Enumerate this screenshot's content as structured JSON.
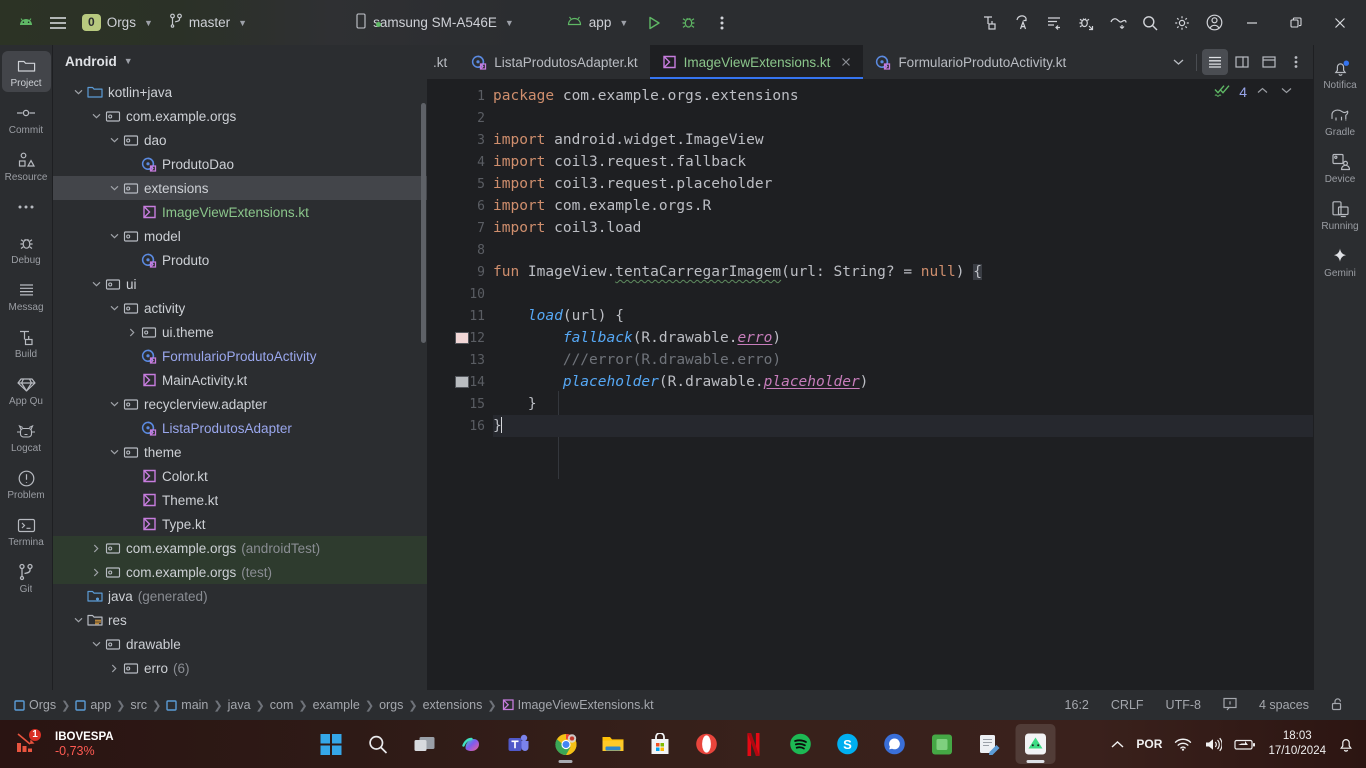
{
  "toolbar": {
    "project_badge": "0",
    "project_name": "Orgs",
    "branch": "master",
    "device": "samsung SM-A546E",
    "run_config": "app",
    "icons": {
      "menu": "hamburger-menu-icon",
      "android": "android-logo-icon",
      "branch": "git-branch-icon",
      "device": "phone-icon",
      "run": "run-play-icon",
      "debug": "debug-bug-icon",
      "more": "more-vertical-icon",
      "build": "build-hammer-icon",
      "translate": "code-with-me-icon",
      "lint": "inspections-icon",
      "attach_debug": "attach-debugger-icon",
      "profiler": "profiler-icon",
      "search": "search-icon",
      "settings": "gear-icon",
      "account": "account-icon",
      "minimize": "minimize-icon",
      "maximize": "restore-icon",
      "close": "close-icon"
    }
  },
  "left_rail": [
    {
      "label": "Project",
      "icon": "folder-icon",
      "active": true
    },
    {
      "label": "Commit",
      "icon": "commit-icon",
      "active": false
    },
    {
      "label": "Resource",
      "icon": "resource-manager-icon",
      "active": false
    },
    {
      "label": "",
      "icon": "more-horizontal-icon",
      "active": false
    },
    {
      "label": "Debug",
      "icon": "debug-bug-icon",
      "active": false
    },
    {
      "label": "Messag",
      "icon": "messages-icon",
      "active": false
    },
    {
      "label": "Build",
      "icon": "build-hammer-icon",
      "active": false
    },
    {
      "label": "App Qu",
      "icon": "app-quality-icon",
      "active": false
    },
    {
      "label": "Logcat",
      "icon": "logcat-cat-icon",
      "active": false
    },
    {
      "label": "Problem",
      "icon": "problems-icon",
      "active": false
    },
    {
      "label": "Termina",
      "icon": "terminal-icon",
      "active": false
    },
    {
      "label": "Git",
      "icon": "git-branch-icon",
      "active": false
    }
  ],
  "right_rail": [
    {
      "label": "Notifica",
      "icon": "notifications-bell-icon",
      "dot": true
    },
    {
      "label": "Gradle",
      "icon": "gradle-elephant-icon",
      "dot": false
    },
    {
      "label": "Device ",
      "icon": "device-manager-icon",
      "dot": false
    },
    {
      "label": "Running",
      "icon": "running-devices-icon",
      "dot": false
    },
    {
      "label": "Gemini",
      "icon": "gemini-sparkle-icon",
      "dot": false
    }
  ],
  "project_panel": {
    "title": "Android",
    "tree": [
      {
        "depth": 1,
        "arrow": "down",
        "icon": "folder-blue",
        "label": "kotlin+java",
        "color": ""
      },
      {
        "depth": 2,
        "arrow": "down",
        "icon": "package",
        "label": "com.example.orgs",
        "color": ""
      },
      {
        "depth": 3,
        "arrow": "down",
        "icon": "package",
        "label": "dao",
        "color": ""
      },
      {
        "depth": 4,
        "arrow": "none",
        "icon": "kt-class",
        "label": "ProdutoDao",
        "color": ""
      },
      {
        "depth": 3,
        "arrow": "down",
        "icon": "package",
        "label": "extensions",
        "color": "",
        "selected": true
      },
      {
        "depth": 4,
        "arrow": "none",
        "icon": "kt-file",
        "label": "ImageViewExtensions.kt",
        "color": "green"
      },
      {
        "depth": 3,
        "arrow": "down",
        "icon": "package",
        "label": "model",
        "color": ""
      },
      {
        "depth": 4,
        "arrow": "none",
        "icon": "kt-class",
        "label": "Produto",
        "color": ""
      },
      {
        "depth": 2,
        "arrow": "down",
        "icon": "package",
        "label": "ui",
        "color": ""
      },
      {
        "depth": 3,
        "arrow": "down",
        "icon": "package",
        "label": "activity",
        "color": ""
      },
      {
        "depth": 4,
        "arrow": "right",
        "icon": "package",
        "label": "ui.theme",
        "color": ""
      },
      {
        "depth": 4,
        "arrow": "none",
        "icon": "kt-class",
        "label": "FormularioProdutoActivity",
        "color": "blue"
      },
      {
        "depth": 4,
        "arrow": "none",
        "icon": "kt-file",
        "label": "MainActivity.kt",
        "color": ""
      },
      {
        "depth": 3,
        "arrow": "down",
        "icon": "package",
        "label": "recyclerview.adapter",
        "color": ""
      },
      {
        "depth": 4,
        "arrow": "none",
        "icon": "kt-class",
        "label": "ListaProdutosAdapter",
        "color": "blue"
      },
      {
        "depth": 3,
        "arrow": "down",
        "icon": "package",
        "label": "theme",
        "color": ""
      },
      {
        "depth": 4,
        "arrow": "none",
        "icon": "kt-file",
        "label": "Color.kt",
        "color": ""
      },
      {
        "depth": 4,
        "arrow": "none",
        "icon": "kt-file",
        "label": "Theme.kt",
        "color": ""
      },
      {
        "depth": 4,
        "arrow": "none",
        "icon": "kt-file",
        "label": "Type.kt",
        "color": ""
      },
      {
        "depth": 2,
        "arrow": "right",
        "icon": "package",
        "label": "com.example.orgs",
        "muted": "(androidTest)",
        "testsrc": true
      },
      {
        "depth": 2,
        "arrow": "right",
        "icon": "package",
        "label": "com.example.orgs",
        "muted": "(test)",
        "testsrc": true
      },
      {
        "depth": 1,
        "arrow": "none",
        "icon": "folder-gen",
        "label": "java",
        "muted": "(generated)"
      },
      {
        "depth": 1,
        "arrow": "down",
        "icon": "folder-res",
        "label": "res"
      },
      {
        "depth": 2,
        "arrow": "down",
        "icon": "package",
        "label": "drawable"
      },
      {
        "depth": 3,
        "arrow": "right",
        "icon": "package",
        "label": "erro",
        "muted": "(6)"
      }
    ]
  },
  "editor": {
    "tabs": [
      {
        "label": ".kt",
        "icon": "",
        "active": false,
        "partial": true
      },
      {
        "label": "ListaProdutosAdapter.kt",
        "icon": "kt-class",
        "active": false
      },
      {
        "label": "ImageViewExtensions.kt",
        "icon": "kt-file",
        "active": true,
        "closable": true
      },
      {
        "label": "FormularioProdutoActivity.kt",
        "icon": "kt-class",
        "active": false
      }
    ],
    "tab_actions": {
      "chevron": "chevron-down-icon",
      "list": "file-structure-icon",
      "split": "split-editor-icon",
      "preview": "preview-icon",
      "more": "more-vertical-icon"
    },
    "inspection": {
      "status_icon": "inspections-ok-icon",
      "count": "4",
      "up": "▲",
      "down": "▼"
    },
    "lines": [
      {
        "n": "1",
        "segments": [
          {
            "t": "package ",
            "c": "k"
          },
          {
            "t": "com.example.orgs.extensions",
            "c": ""
          }
        ]
      },
      {
        "n": "2",
        "segments": []
      },
      {
        "n": "3",
        "segments": [
          {
            "t": "import ",
            "c": "k"
          },
          {
            "t": "android.widget.ImageView",
            "c": ""
          }
        ]
      },
      {
        "n": "4",
        "segments": [
          {
            "t": "import ",
            "c": "k"
          },
          {
            "t": "coil3.request.fallback",
            "c": ""
          }
        ]
      },
      {
        "n": "5",
        "segments": [
          {
            "t": "import ",
            "c": "k"
          },
          {
            "t": "coil3.request.placeholder",
            "c": ""
          }
        ]
      },
      {
        "n": "6",
        "segments": [
          {
            "t": "import ",
            "c": "k"
          },
          {
            "t": "com.example.orgs.R",
            "c": ""
          }
        ]
      },
      {
        "n": "7",
        "segments": [
          {
            "t": "import ",
            "c": "k"
          },
          {
            "t": "coil3.load",
            "c": ""
          }
        ]
      },
      {
        "n": "8",
        "segments": []
      },
      {
        "n": "9",
        "segments": [
          {
            "t": "fun ",
            "c": "k"
          },
          {
            "t": "ImageView.",
            "c": ""
          },
          {
            "t": "tentaCarregarImagem",
            "c": "squig"
          },
          {
            "t": "(url: String? = ",
            "c": ""
          },
          {
            "t": "null",
            "c": "k"
          },
          {
            "t": ") ",
            "c": ""
          },
          {
            "t": "{",
            "c": "brace"
          }
        ]
      },
      {
        "n": "10",
        "segments": []
      },
      {
        "n": "11",
        "segments": [
          {
            "t": "    ",
            "c": ""
          },
          {
            "t": "load",
            "c": "it"
          },
          {
            "t": "(url) {",
            "c": ""
          }
        ]
      },
      {
        "n": "12",
        "swatch": "#f2d7d7",
        "segments": [
          {
            "t": "        ",
            "c": ""
          },
          {
            "t": "fallback",
            "c": "it"
          },
          {
            "t": "(R.drawable.",
            "c": ""
          },
          {
            "t": "erro",
            "c": "res"
          },
          {
            "t": ")",
            "c": ""
          }
        ]
      },
      {
        "n": "13",
        "segments": [
          {
            "t": "        ///error(R.drawable.erro)",
            "c": "cmt"
          }
        ]
      },
      {
        "n": "14",
        "swatch": "#b9bcc0",
        "segments": [
          {
            "t": "        ",
            "c": ""
          },
          {
            "t": "placeholder",
            "c": "it"
          },
          {
            "t": "(R.drawable.",
            "c": ""
          },
          {
            "t": "placeholder",
            "c": "res"
          },
          {
            "t": ")",
            "c": ""
          }
        ]
      },
      {
        "n": "15",
        "segments": [
          {
            "t": "    }",
            "c": ""
          }
        ]
      },
      {
        "n": "16",
        "current": true,
        "segments": [
          {
            "t": "}",
            "c": ""
          }
        ]
      }
    ]
  },
  "status_bar": {
    "breadcrumb": [
      {
        "label": "Orgs",
        "icon": "module-icon"
      },
      {
        "label": "app",
        "icon": "module-icon"
      },
      {
        "label": "src",
        "icon": ""
      },
      {
        "label": "main",
        "icon": "module-icon"
      },
      {
        "label": "java",
        "icon": ""
      },
      {
        "label": "com",
        "icon": ""
      },
      {
        "label": "example",
        "icon": ""
      },
      {
        "label": "orgs",
        "icon": ""
      },
      {
        "label": "extensions",
        "icon": ""
      },
      {
        "label": "ImageViewExtensions.kt",
        "icon": "kt-file"
      }
    ],
    "position": "16:2",
    "line_ending": "CRLF",
    "encoding": "UTF-8",
    "notifications_icon": "event-log-icon",
    "indent": "4 spaces",
    "lock_icon": "unlocked-padlock-icon"
  },
  "taskbar": {
    "news": {
      "title": "IBOVESPA",
      "value": "-0,73%",
      "badge": "1",
      "icon": "stock-down-icon"
    },
    "apps": [
      {
        "name": "start-button",
        "icon": "windows-logo"
      },
      {
        "name": "search-taskbar",
        "icon": "search-icon"
      },
      {
        "name": "task-view",
        "icon": "task-view-icon"
      },
      {
        "name": "copilot",
        "icon": "copilot-icon"
      },
      {
        "name": "teams",
        "icon": "teams-icon"
      },
      {
        "name": "chrome",
        "icon": "chrome-icon",
        "running": true
      },
      {
        "name": "file-explorer",
        "icon": "folder-icon"
      },
      {
        "name": "microsoft-store",
        "icon": "store-icon"
      },
      {
        "name": "opera",
        "icon": "opera-icon"
      },
      {
        "name": "netflix",
        "icon": "netflix-icon"
      },
      {
        "name": "spotify",
        "icon": "spotify-icon"
      },
      {
        "name": "skype",
        "icon": "skype-icon"
      },
      {
        "name": "whatsapp",
        "icon": "whatsapp-icon"
      },
      {
        "name": "app-green",
        "icon": "green-app-icon"
      },
      {
        "name": "notepad",
        "icon": "notepad-icon"
      },
      {
        "name": "android-studio",
        "icon": "android-studio-icon",
        "active": true
      }
    ],
    "tray": {
      "overflow": "chevron-up-icon",
      "language": "POR",
      "wifi": "wifi-icon",
      "volume": "volume-icon",
      "battery": "battery-icon",
      "time": "18:03",
      "date": "17/10/2024",
      "notifications": "bell-icon"
    }
  }
}
